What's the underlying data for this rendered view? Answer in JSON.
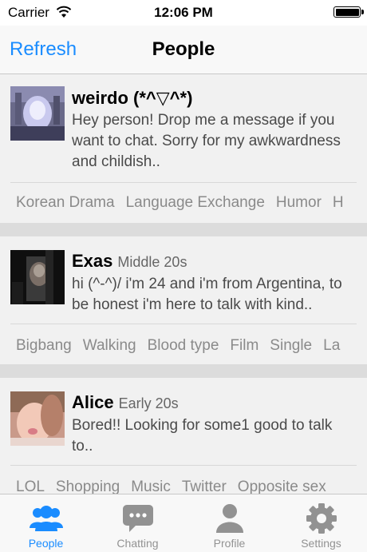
{
  "status_bar": {
    "carrier": "Carrier",
    "time": "12:06 PM"
  },
  "nav": {
    "refresh_label": "Refresh",
    "title": "People"
  },
  "people": [
    {
      "name": "weirdo (*^▽^*)",
      "age": "",
      "message": "Hey person! Drop me a message if you want to chat. Sorry for my awkwardness and childish..",
      "tags": [
        "Korean Drama",
        "Language Exchange",
        "Humor",
        "H"
      ]
    },
    {
      "name": "Exas",
      "age": "Middle 20s",
      "message": "hi (^-^)/ i'm 24 and i'm from Argentina, to be honest i'm here to talk with kind..",
      "tags": [
        "Bigbang",
        "Walking",
        "Blood type",
        "Film",
        "Single",
        "La"
      ]
    },
    {
      "name": "Alice",
      "age": "Early 20s",
      "message": "Bored!! Looking for some1 good to talk to..",
      "tags": [
        "LOL",
        "Shopping",
        "Music",
        "Twitter",
        "Opposite sex"
      ]
    }
  ],
  "tabs": [
    {
      "label": "People",
      "icon": "people-icon",
      "active": true
    },
    {
      "label": "Chatting",
      "icon": "chat-bubble-icon",
      "active": false
    },
    {
      "label": "Profile",
      "icon": "profile-icon",
      "active": false
    },
    {
      "label": "Settings",
      "icon": "gear-icon",
      "active": false
    }
  ],
  "colors": {
    "accent": "#1a8cff",
    "inactive_tab": "#929292"
  }
}
